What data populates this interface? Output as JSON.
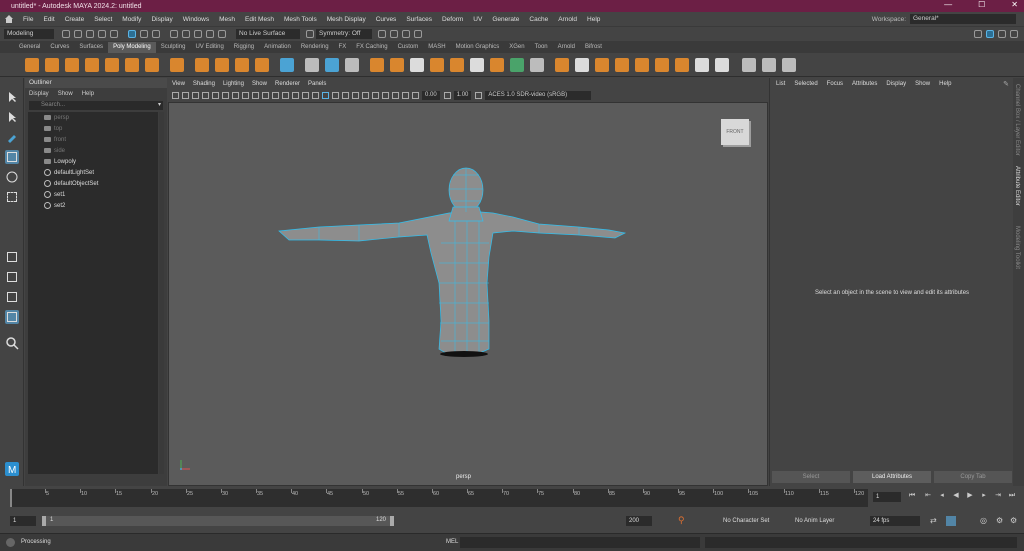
{
  "window": {
    "title": "untitled* - Autodesk MAYA 2024.2: untitled",
    "min": "—",
    "max": "☐",
    "close": "✕"
  },
  "menubar": [
    "File",
    "Edit",
    "Create",
    "Select",
    "Modify",
    "Display",
    "Windows",
    "Mesh",
    "Edit Mesh",
    "Mesh Tools",
    "Mesh Display",
    "Curves",
    "Surfaces",
    "Deform",
    "UV",
    "Generate",
    "Cache",
    "Arnold",
    "Help"
  ],
  "workspace": {
    "label": "Workspace:",
    "value": "General*"
  },
  "statusline": {
    "mode": "Modeling",
    "live_surface": "No Live Surface",
    "symmetry": "Symmetry: Off"
  },
  "shelf_tabs": [
    "General",
    "Curves",
    "Surfaces",
    "Poly Modeling",
    "Sculpting",
    "UV Editing",
    "Rigging",
    "Animation",
    "Rendering",
    "FX",
    "FX Caching",
    "Custom",
    "MASH",
    "Motion Graphics",
    "XGen",
    "Toon",
    "Arnold",
    "Bifrost"
  ],
  "shelf_active": "Poly Modeling",
  "outliner": {
    "title": "Outliner",
    "menu": [
      "Display",
      "Show",
      "Help"
    ],
    "search_placeholder": "Search...",
    "items": [
      {
        "label": "persp",
        "kind": "camera",
        "dim": true
      },
      {
        "label": "top",
        "kind": "camera",
        "dim": true
      },
      {
        "label": "front",
        "kind": "camera",
        "dim": true
      },
      {
        "label": "side",
        "kind": "camera",
        "dim": true
      },
      {
        "label": "Lowpoly",
        "kind": "mesh",
        "dim": false
      },
      {
        "label": "defaultLightSet",
        "kind": "set",
        "dim": false
      },
      {
        "label": "defaultObjectSet",
        "kind": "set",
        "dim": false
      },
      {
        "label": "set1",
        "kind": "set",
        "dim": false
      },
      {
        "label": "set2",
        "kind": "set",
        "dim": false
      }
    ]
  },
  "viewport": {
    "menu": [
      "View",
      "Shading",
      "Lighting",
      "Show",
      "Renderer",
      "Panels"
    ],
    "exposure": "0.00",
    "gamma": "1.00",
    "color_space": "ACES 1.0 SDR-video (sRGB)",
    "viewcube": "FRONT",
    "camera_label": "persp"
  },
  "attribute_editor": {
    "menu": [
      "List",
      "Selected",
      "Focus",
      "Attributes",
      "Display",
      "Show",
      "Help"
    ],
    "message": "Select an object in the scene to view and edit its attributes",
    "buttons": [
      "Select",
      "Load Attributes",
      "Copy Tab"
    ]
  },
  "side_tabs": [
    "Channel Box / Layer Editor",
    "Attribute Editor",
    "Modeling Toolkit"
  ],
  "timeline": {
    "ticks": [
      "5",
      "10",
      "15",
      "20",
      "25",
      "30",
      "35",
      "40",
      "45",
      "50",
      "55",
      "60",
      "65",
      "70",
      "75",
      "80",
      "85",
      "90",
      "95",
      "100",
      "105",
      "110",
      "115",
      "120"
    ],
    "current_frame": "1"
  },
  "range": {
    "start": "1",
    "inner_start": "1",
    "inner_end": "120",
    "end": "200",
    "character_set": "No Character Set",
    "anim_layer": "No Anim Layer",
    "fps": "24 fps"
  },
  "command": {
    "status": "Processing",
    "lang": "MEL"
  }
}
